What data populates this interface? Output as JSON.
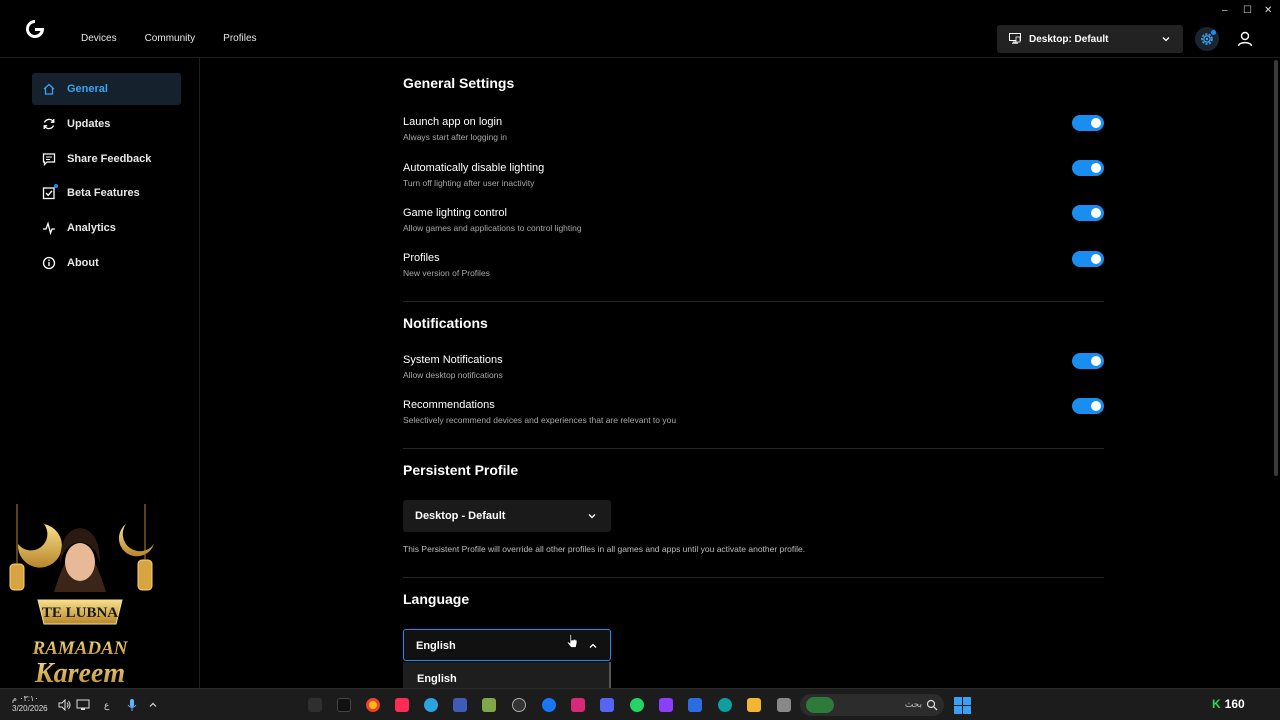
{
  "app": {
    "nav": [
      "Devices",
      "Community",
      "Profiles"
    ],
    "profile_selector": "Desktop: Default",
    "window_controls": [
      "–",
      "☐",
      "✕"
    ]
  },
  "sidebar": {
    "items": [
      {
        "label": "General",
        "icon": "home-icon",
        "active": true
      },
      {
        "label": "Updates",
        "icon": "refresh-icon"
      },
      {
        "label": "Share Feedback",
        "icon": "chat-icon"
      },
      {
        "label": "Beta Features",
        "icon": "beta-check-icon"
      },
      {
        "label": "Analytics",
        "icon": "pulse-icon"
      },
      {
        "label": "About",
        "icon": "info-icon"
      }
    ]
  },
  "general": {
    "title": "General Settings",
    "rows": [
      {
        "title": "Launch app on login",
        "sub": "Always start after logging in",
        "on": true
      },
      {
        "title": "Automatically disable lighting",
        "sub": "Turn off lighting after user inactivity",
        "on": true
      },
      {
        "title": "Game lighting control",
        "sub": "Allow games and applications to control lighting",
        "on": true
      },
      {
        "title": "Profiles",
        "sub": "New version of Profiles",
        "on": true
      }
    ]
  },
  "notifications": {
    "title": "Notifications",
    "rows": [
      {
        "title": "System Notifications",
        "sub": "Allow desktop notifications",
        "on": true
      },
      {
        "title": "Recommendations",
        "sub": "Selectively recommend devices and experiences that are relevant to you",
        "on": true
      }
    ]
  },
  "persistent": {
    "title": "Persistent Profile",
    "value": "Desktop - Default",
    "note": "This Persistent Profile will override all other profiles in all games and apps until you activate another profile."
  },
  "language": {
    "title": "Language",
    "value": "English",
    "options": [
      "English"
    ]
  },
  "overlay": {
    "line1": "TE LUBNA",
    "line2": "RAMADAN",
    "line3": "Kareem"
  },
  "taskbar": {
    "time": "٠٣:١٠ م",
    "date": "3/20/2026",
    "search_placeholder": "بحث",
    "counter": "160",
    "counter_prefix": "K",
    "lang": "ع"
  },
  "colors": {
    "accent": "#1a8ef0",
    "active_bg": "#15222e"
  }
}
